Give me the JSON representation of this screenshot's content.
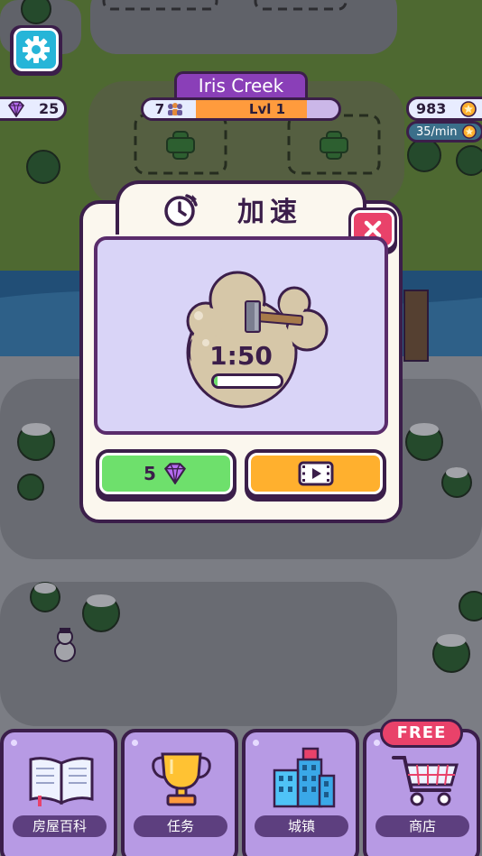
{
  "hud": {
    "town_name": "Iris Creek",
    "population": "7",
    "level_label": "Lvl 1",
    "level_progress": 0.78,
    "gems": "25",
    "coins": "983",
    "coin_rate": "35/min"
  },
  "modal": {
    "title": "加速",
    "timer": "1:50",
    "timer_progress": 0.05,
    "gem_cost": "5"
  },
  "bottom_nav": {
    "items": [
      {
        "label": "房屋百科",
        "icon": "book-icon"
      },
      {
        "label": "任务",
        "icon": "trophy-icon"
      },
      {
        "label": "城镇",
        "icon": "city-icon"
      },
      {
        "label": "商店",
        "icon": "shop-cart-icon"
      }
    ],
    "free_badge": "FREE"
  },
  "colors": {
    "accent_purple": "#8a3fb8",
    "outline": "#3b1e4a",
    "close_red": "#e9426a",
    "gem_green": "#6ee06c",
    "video_orange": "#ffb02e",
    "level_orange": "#ff9b3d",
    "settings_teal": "#26b5d8"
  }
}
